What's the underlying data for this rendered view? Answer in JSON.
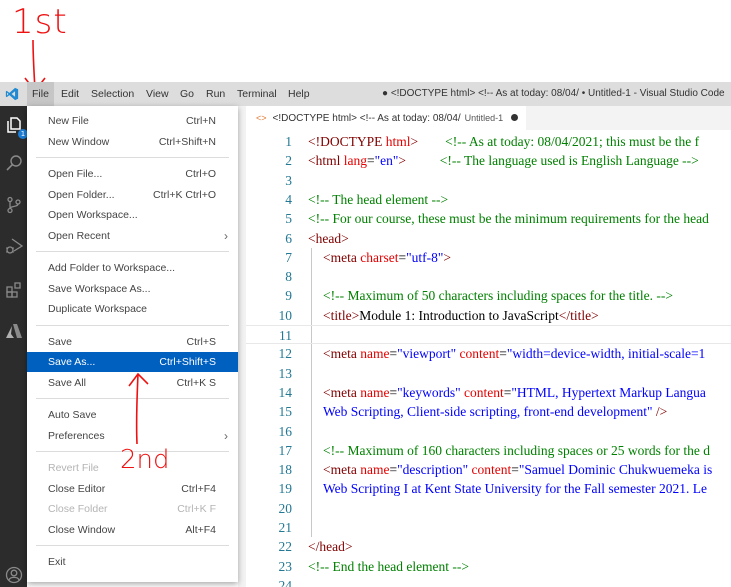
{
  "annotations": {
    "first": "1st",
    "second": "2nd"
  },
  "titlebar": {
    "menus": [
      "File",
      "Edit",
      "Selection",
      "View",
      "Go",
      "Run",
      "Terminal",
      "Help"
    ],
    "window_title": "● <!DOCTYPE html> <!-- As at today: 08/04/ • Untitled-1 - Visual Studio Code"
  },
  "activity_bar": {
    "icons": [
      "explorer-icon",
      "search-icon",
      "source-control-icon",
      "run-debug-icon",
      "extensions-icon",
      "azure-icon",
      "account-icon"
    ],
    "explorer_badge": "1"
  },
  "tab": {
    "label": "<!DOCTYPE html> <!-- As at today: 08/04/",
    "description": "Untitled-1",
    "dirty": true
  },
  "file_menu": {
    "groups": [
      [
        {
          "label": "New File",
          "shortcut": "Ctrl+N"
        },
        {
          "label": "New Window",
          "shortcut": "Ctrl+Shift+N"
        }
      ],
      [
        {
          "label": "Open File...",
          "shortcut": "Ctrl+O"
        },
        {
          "label": "Open Folder...",
          "shortcut": "Ctrl+K Ctrl+O"
        },
        {
          "label": "Open Workspace...",
          "shortcut": ""
        },
        {
          "label": "Open Recent",
          "shortcut": "",
          "submenu": true
        }
      ],
      [
        {
          "label": "Add Folder to Workspace...",
          "shortcut": ""
        },
        {
          "label": "Save Workspace As...",
          "shortcut": ""
        },
        {
          "label": "Duplicate Workspace",
          "shortcut": ""
        }
      ],
      [
        {
          "label": "Save",
          "shortcut": "Ctrl+S"
        },
        {
          "label": "Save As...",
          "shortcut": "Ctrl+Shift+S",
          "selected": true
        },
        {
          "label": "Save All",
          "shortcut": "Ctrl+K S"
        }
      ],
      [
        {
          "label": "Auto Save",
          "shortcut": ""
        },
        {
          "label": "Preferences",
          "shortcut": "",
          "submenu": true
        }
      ],
      [
        {
          "label": "Revert File",
          "shortcut": "",
          "disabled": true
        },
        {
          "label": "Close Editor",
          "shortcut": "Ctrl+F4"
        },
        {
          "label": "Close Folder",
          "shortcut": "Ctrl+K F",
          "disabled": true
        },
        {
          "label": "Close Window",
          "shortcut": "Alt+F4"
        }
      ],
      [
        {
          "label": "Exit",
          "shortcut": ""
        }
      ]
    ]
  },
  "editor": {
    "current_line": 11,
    "lines": [
      {
        "n": "1",
        "indent": false,
        "tokens": [
          [
            "tag",
            "<!DOCTYPE "
          ],
          [
            "attr",
            "html"
          ],
          [
            "tag",
            ">"
          ],
          [
            "txt",
            "        "
          ],
          [
            "cmt",
            "<!-- As at today: 08/04/2021; this must be the f"
          ]
        ]
      },
      {
        "n": "2",
        "indent": false,
        "tokens": [
          [
            "tag",
            "<html "
          ],
          [
            "attr",
            "lang"
          ],
          [
            "txt",
            "="
          ],
          [
            "str",
            "\"en\""
          ],
          [
            "tag",
            ">"
          ],
          [
            "txt",
            "          "
          ],
          [
            "cmt",
            "<!-- The language used is English Language -->"
          ]
        ]
      },
      {
        "n": "3",
        "indent": false,
        "tokens": []
      },
      {
        "n": "4",
        "indent": false,
        "tokens": [
          [
            "cmt",
            "<!-- The head element -->"
          ]
        ]
      },
      {
        "n": "5",
        "indent": false,
        "tokens": [
          [
            "cmt",
            "<!-- For our course, these must be the minimum requirements for the head"
          ]
        ]
      },
      {
        "n": "6",
        "indent": false,
        "tokens": [
          [
            "tag",
            "<head>"
          ]
        ]
      },
      {
        "n": "7",
        "indent": true,
        "tokens": [
          [
            "tag",
            "<meta "
          ],
          [
            "attr",
            "charset"
          ],
          [
            "txt",
            "="
          ],
          [
            "str",
            "\"utf-8\""
          ],
          [
            "tag",
            ">"
          ]
        ]
      },
      {
        "n": "8",
        "indent": true,
        "tokens": []
      },
      {
        "n": "9",
        "indent": true,
        "tokens": [
          [
            "cmt",
            "<!-- Maximum of 50 characters including spaces for the title. -->"
          ]
        ]
      },
      {
        "n": "10",
        "indent": true,
        "tokens": [
          [
            "tag",
            "<title>"
          ],
          [
            "txt",
            "Module 1: Introduction to JavaScript"
          ],
          [
            "tag",
            "</title>"
          ]
        ]
      },
      {
        "n": "11",
        "indent": true,
        "tokens": []
      },
      {
        "n": "12",
        "indent": true,
        "tokens": [
          [
            "tag",
            "<meta "
          ],
          [
            "attr",
            "name"
          ],
          [
            "txt",
            "="
          ],
          [
            "str",
            "\"viewport\" "
          ],
          [
            "attr",
            "content"
          ],
          [
            "txt",
            "="
          ],
          [
            "str",
            "\"width=device-width, initial-scale=1"
          ]
        ]
      },
      {
        "n": "13",
        "indent": true,
        "tokens": []
      },
      {
        "n": "14",
        "indent": true,
        "tokens": [
          [
            "tag",
            "<meta "
          ],
          [
            "attr",
            "name"
          ],
          [
            "txt",
            "="
          ],
          [
            "str",
            "\"keywords\" "
          ],
          [
            "attr",
            "content"
          ],
          [
            "txt",
            "="
          ],
          [
            "str",
            "\"HTML, Hypertext Markup Langua"
          ]
        ]
      },
      {
        "n": "15",
        "indent": true,
        "tokens": [
          [
            "str",
            "Web Scripting, Client-side scripting, front-end development\" "
          ],
          [
            "tag",
            "/>"
          ]
        ]
      },
      {
        "n": "16",
        "indent": true,
        "tokens": []
      },
      {
        "n": "17",
        "indent": true,
        "tokens": [
          [
            "cmt",
            "<!-- Maximum of 160 characters including spaces or 25 words for the d"
          ]
        ]
      },
      {
        "n": "18",
        "indent": true,
        "tokens": [
          [
            "tag",
            "<meta "
          ],
          [
            "attr",
            "name"
          ],
          [
            "txt",
            "="
          ],
          [
            "str",
            "\"description\" "
          ],
          [
            "attr",
            "content"
          ],
          [
            "txt",
            "="
          ],
          [
            "str",
            "\"Samuel Dominic Chukwuemeka is"
          ]
        ]
      },
      {
        "n": "19",
        "indent": true,
        "tokens": [
          [
            "str",
            "Web Scripting I at Kent State University for the Fall semester 2021. Le"
          ]
        ]
      },
      {
        "n": "20",
        "indent": true,
        "tokens": []
      },
      {
        "n": "21",
        "indent": true,
        "tokens": []
      },
      {
        "n": "22",
        "indent": false,
        "tokens": [
          [
            "tag",
            "</head>"
          ]
        ]
      },
      {
        "n": "23",
        "indent": false,
        "tokens": [
          [
            "cmt",
            "<!-- End the head element -->"
          ]
        ]
      },
      {
        "n": "24",
        "indent": false,
        "tokens": []
      }
    ]
  }
}
